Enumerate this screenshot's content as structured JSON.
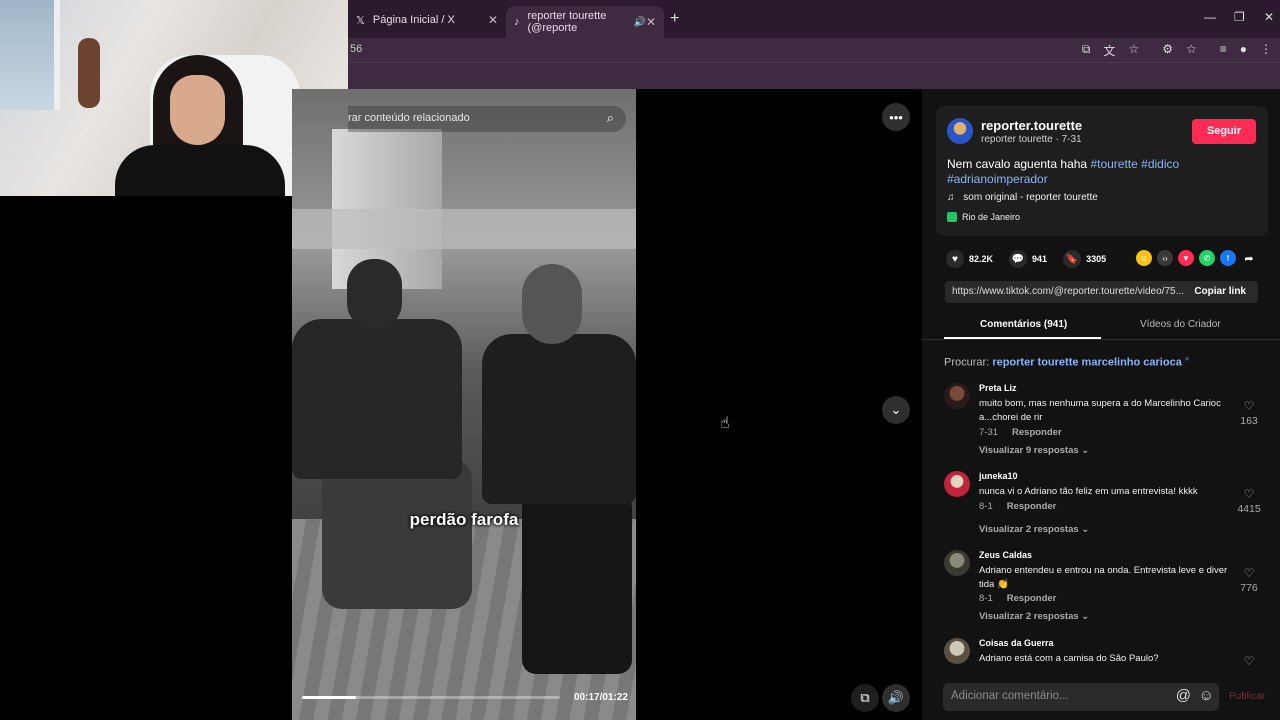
{
  "browser": {
    "tabs": [
      {
        "label": "Página Inicial / X",
        "icon": "x-logo-icon"
      },
      {
        "label": "reporter tourette (@reporte",
        "icon": "tiktok-icon"
      }
    ],
    "address_fragment": "56"
  },
  "video": {
    "search_placeholder": "rar conteúdo relacionado",
    "caption": "perdão farofa",
    "time": "00:17/01:22",
    "progress": 0.21
  },
  "author": {
    "username": "reporter.tourette",
    "subline": "reporter tourette · 7-31",
    "follow_label": "Seguir",
    "description_prefix": "Nem cavalo aguenta haha ",
    "tags": [
      "#tourette",
      "#didico",
      "#adrianoimperador"
    ],
    "music": "som original - reporter tourette",
    "location": "Rio de Janeiro"
  },
  "stats": {
    "likes": "82.2K",
    "comments": "941",
    "saves": "3305"
  },
  "share_colors": {
    "coin": "#f7c21a",
    "embed": "#3a3a3a",
    "send": "#fe2c55",
    "whatsapp": "#25d366",
    "facebook": "#1877f2"
  },
  "link": {
    "url": "https://www.tiktok.com/@reporter.tourette/video/75...",
    "copy_label": "Copiar link"
  },
  "panel_tabs": {
    "comments": "Comentários (941)",
    "creator": "Vídeos do Criador"
  },
  "search_suggestion": {
    "label": "Procurar:",
    "query": "reporter tourette marcelinho carioca"
  },
  "comments": [
    {
      "name": "Preta Liz",
      "text": "muito bom, mas nenhuma supera a do Marcelinho Carioc a...chorei de rir",
      "date": "7-31",
      "reply": "Responder",
      "replies": "Visualizar 9 respostas",
      "likes": "163"
    },
    {
      "name": "juneka10",
      "text": "nunca vi o Adriano tão feliz em uma entrevista! kkkk",
      "date": "8-1",
      "reply": "Responder",
      "replies": "Visualizar 2 respostas",
      "likes": "4415"
    },
    {
      "name": "Zeus Caldas",
      "text": "Adriano entendeu e entrou na onda. Entrevista leve e diver tida 👏",
      "date": "8-1",
      "reply": "Responder",
      "replies": "Visualizar 2 respostas",
      "likes": "776"
    },
    {
      "name": "Coisas da Guerra",
      "text": "Adriano está com a camisa do São Paulo?",
      "date": "",
      "reply": "",
      "replies": "",
      "likes": ""
    }
  ],
  "composer": {
    "placeholder": "Adicionar comentário...",
    "publish": "Publicar"
  }
}
